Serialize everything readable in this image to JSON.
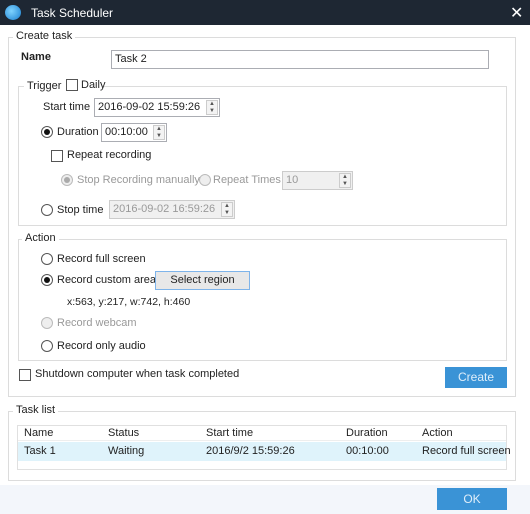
{
  "window": {
    "title": "Task Scheduler",
    "close_icon": "close-icon"
  },
  "create": {
    "legend": "Create task",
    "name_label": "Name",
    "name_value": "Task 2",
    "trigger": {
      "legend": "Trigger",
      "daily_label": "Daily",
      "daily_checked": false,
      "start_label": "Start time",
      "start_value": "2016-09-02 15:59:26",
      "duration_label": "Duration",
      "duration_value": "00:10:00",
      "duration_selected": true,
      "repeat_label": "Repeat recording",
      "repeat_checked": false,
      "stop_manual_label": "Stop Recording manually",
      "repeat_times_label": "Repeat Times",
      "repeat_times_value": "10",
      "stop_time_label": "Stop time",
      "stop_time_value": "2016-09-02 16:59:26"
    },
    "action": {
      "legend": "Action",
      "full_label": "Record full screen",
      "custom_label": "Record custom area",
      "select_region_label": "Select region",
      "region_text": "x:563, y:217, w:742, h:460",
      "webcam_label": "Record webcam",
      "audio_label": "Record only audio",
      "selected": "Record custom area"
    },
    "shutdown_label": "Shutdown computer when task completed",
    "create_label": "Create"
  },
  "task_list": {
    "legend": "Task list",
    "columns": [
      "Name",
      "Status",
      "Start time",
      "Duration",
      "Action"
    ],
    "rows": [
      [
        "Task 1",
        "Waiting",
        "2016/9/2 15:59:26",
        "00:10:00",
        "Record full screen"
      ]
    ]
  },
  "ok_label": "OK",
  "colors": {
    "titlebar": "#1e2733",
    "accent": "#3a93d6",
    "row_selected": "#dff3fb"
  }
}
